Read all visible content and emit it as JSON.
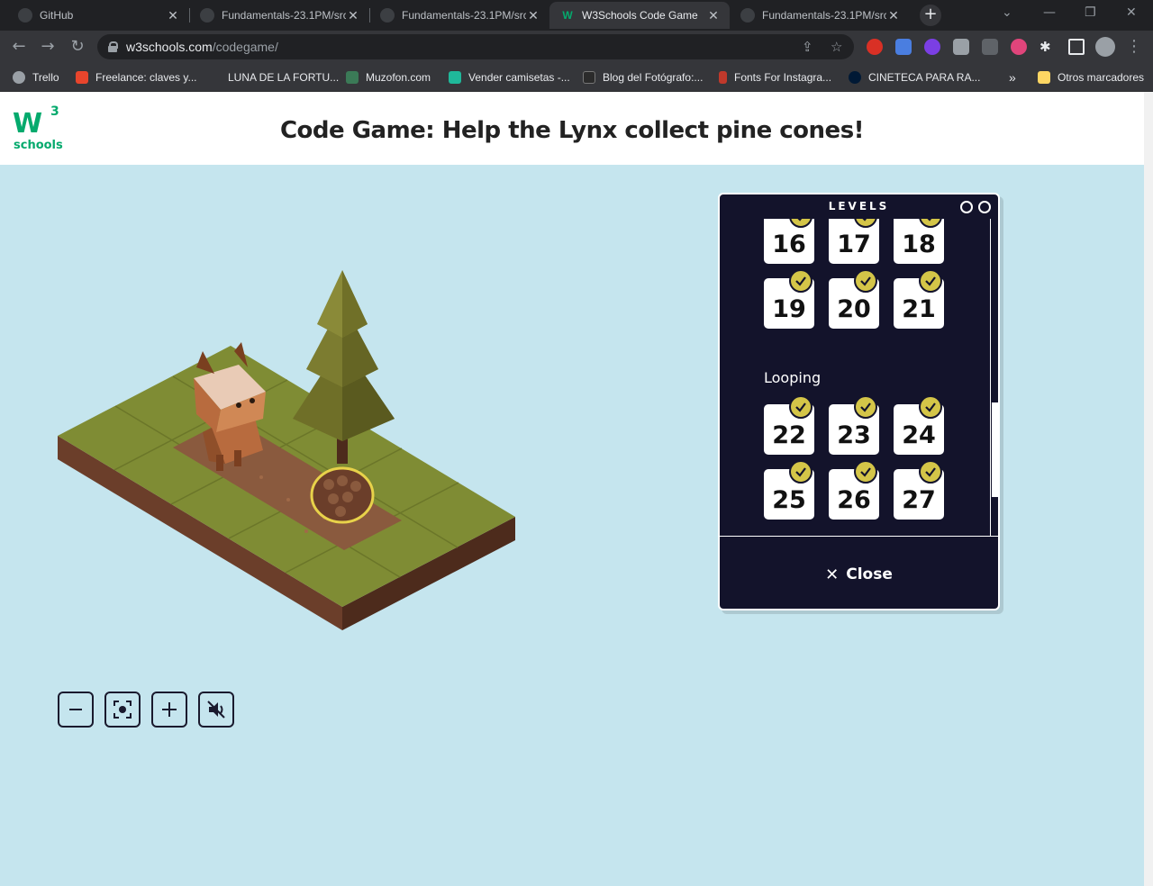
{
  "browser": {
    "tabs": [
      {
        "title": "GitHub"
      },
      {
        "title": "Fundamentals-23.1PM/src"
      },
      {
        "title": "Fundamentals-23.1PM/src"
      },
      {
        "title": "W3Schools Code Game"
      },
      {
        "title": "Fundamentals-23.1PM/src"
      }
    ],
    "new_tab": "+",
    "url_host": "w3schools.com",
    "url_path": "/codegame/",
    "bookmarks": [
      {
        "label": "Trello"
      },
      {
        "label": "Freelance: claves y..."
      },
      {
        "label": "LUNA DE LA FORTU..."
      },
      {
        "label": "Muzofon.com"
      },
      {
        "label": "Vender camisetas -..."
      },
      {
        "label": "Blog del Fotógrafo:..."
      },
      {
        "label": "Fonts For Instagra..."
      },
      {
        "label": "CINETECA PARA RA..."
      }
    ],
    "more_bookmarks": "»",
    "other_bookmarks": "Otros marcadores"
  },
  "page": {
    "logo_mark": "W",
    "logo_superscript": "3",
    "logo_text": "schools",
    "title": "Code Game: Help the Lynx collect pine cones!"
  },
  "levels_panel": {
    "title": "LEVELS",
    "rows_top": [
      [
        "16",
        "17",
        "18"
      ],
      [
        "19",
        "20",
        "21"
      ]
    ],
    "section_label": "Looping",
    "rows_bottom": [
      [
        "22",
        "23",
        "24"
      ],
      [
        "25",
        "26",
        "27"
      ]
    ],
    "close_label": "Close"
  },
  "colors": {
    "page_bg": "#c5e5ee",
    "panel_bg": "#13132b",
    "check_badge": "#d4c548",
    "brand_green": "#04aa6d"
  }
}
